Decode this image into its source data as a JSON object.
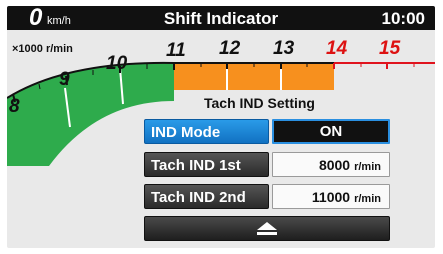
{
  "status_bar": {
    "speed_value": "0",
    "speed_unit": "km/h",
    "title": "Shift Indicator",
    "clock": "10:00"
  },
  "tachometer": {
    "scale_label": "×1000 r/min",
    "tick_labels": [
      "8",
      "9",
      "10",
      "11",
      "12",
      "13",
      "14",
      "15"
    ],
    "redline_from": "14",
    "colors": {
      "green": "#2eab4c",
      "orange": "#f7901e",
      "red": "#e0141e",
      "redline_text": "#dd1111"
    }
  },
  "settings": {
    "title": "Tach IND Setting",
    "rows": [
      {
        "label": "IND Mode",
        "value": "ON",
        "unit": "",
        "active": true
      },
      {
        "label": "Tach IND 1st",
        "value": "8000",
        "unit": "r/min",
        "active": false
      },
      {
        "label": "Tach IND 2nd",
        "value": "11000",
        "unit": "r/min",
        "active": false
      }
    ],
    "eject_icon": "eject-icon"
  },
  "colors": {
    "accent_blue": "#1a88dc",
    "background": "#e9e9e9"
  }
}
